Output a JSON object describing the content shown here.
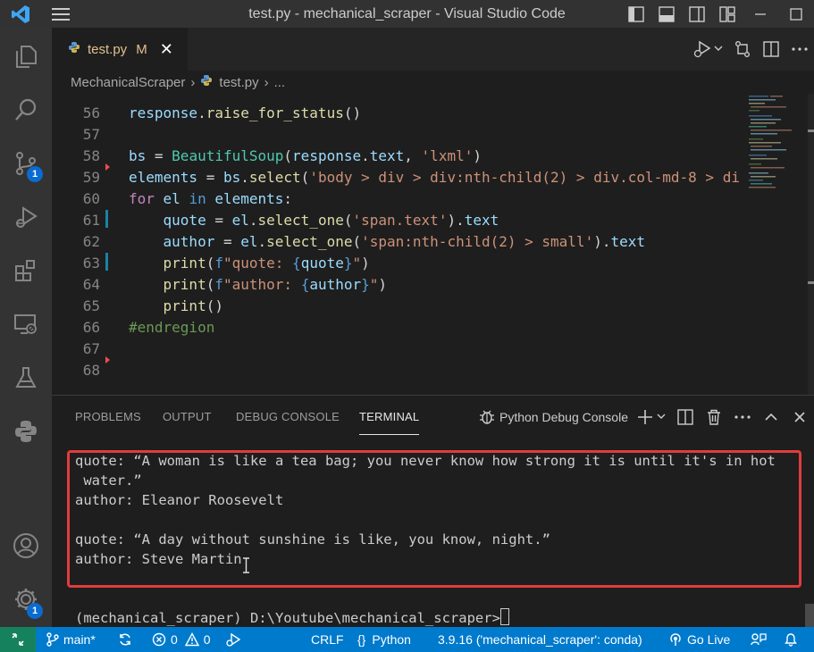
{
  "window": {
    "title": "test.py - mechanical_scraper - Visual Studio Code"
  },
  "tab": {
    "filename": "test.py",
    "modified_marker": "M",
    "close_glyph": "✕"
  },
  "breadcrumb": {
    "folder": "MechanicalScraper",
    "file": "test.py",
    "more": "..."
  },
  "editor": {
    "lines": [
      {
        "n": "56",
        "text": "response.raise_for_status()"
      },
      {
        "n": "57",
        "text": ""
      },
      {
        "n": "58",
        "text": "bs = BeautifulSoup(response.text, 'lxml')"
      },
      {
        "n": "59",
        "text": "elements = bs.select('body > div > div:nth-child(2) > div.col-md-8 > di"
      },
      {
        "n": "60",
        "text": "for el in elements:"
      },
      {
        "n": "61",
        "text": "    quote = el.select_one('span.text').text"
      },
      {
        "n": "62",
        "text": "    author = el.select_one('span:nth-child(2) > small').text"
      },
      {
        "n": "63",
        "text": "    print(f\"quote: {quote}\")"
      },
      {
        "n": "64",
        "text": "    print(f\"author: {author}\")"
      },
      {
        "n": "65",
        "text": "    print()"
      },
      {
        "n": "66",
        "text": "#endregion"
      },
      {
        "n": "67",
        "text": ""
      },
      {
        "n": "68",
        "text": ""
      }
    ]
  },
  "panel": {
    "tabs": {
      "problems": "PROBLEMS",
      "output": "OUTPUT",
      "debug_console": "DEBUG CONSOLE",
      "terminal": "TERMINAL"
    },
    "terminal_selector": "Python Debug Console",
    "terminal_lines": {
      "l1": "quote: “A woman is like a tea bag; you never know how strong it is until it's in hot",
      "l2": " water.”",
      "l3": "author: Eleanor Roosevelt",
      "l4": "quote: “A day without sunshine is like, you know, night.”",
      "l5": "author: Steve Martin",
      "prompt": "(mechanical_scraper) D:\\Youtube\\mechanical_scraper>"
    }
  },
  "activity_bar": {
    "scm_badge": "1",
    "manage_badge": "1"
  },
  "status_bar": {
    "branch": "main*",
    "errors": "0",
    "warnings": "0",
    "eol": "CRLF",
    "language": "Python",
    "interpreter": "3.9.16 ('mechanical_scraper': conda)",
    "go_live": "Go Live"
  },
  "colors": {
    "accent": "#007acc",
    "remote": "#16825d",
    "highlight_box": "#e03c3c",
    "modified_file": "#e2c08d",
    "badge": "#0a6bd0"
  },
  "icons": {
    "app": "vscode-logo-icon",
    "menu": "hamburger-menu-icon",
    "explorer": "files-icon",
    "search": "search-icon",
    "scm": "source-control-icon",
    "debug": "run-debug-icon",
    "extensions": "extensions-icon",
    "remote": "remote-explorer-icon",
    "testing": "beaker-icon",
    "python": "python-icon",
    "account": "account-icon",
    "manage": "gear-icon"
  }
}
